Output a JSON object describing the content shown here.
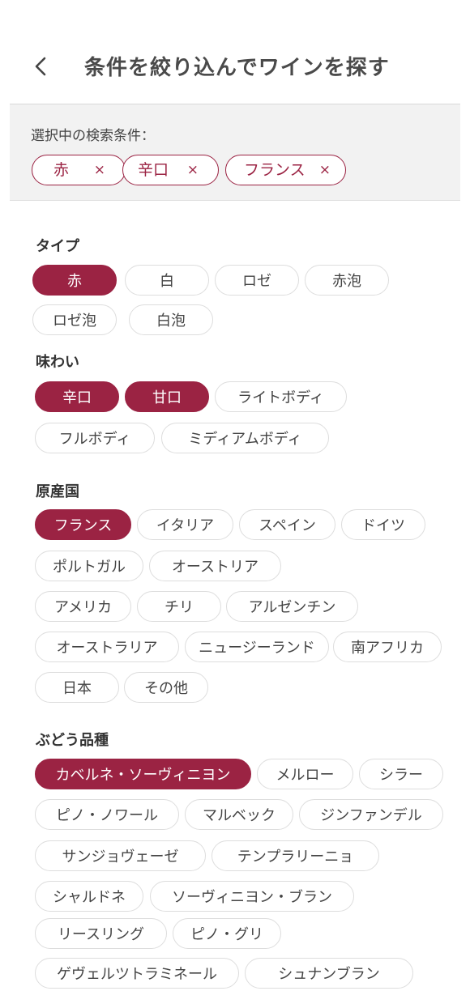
{
  "header": {
    "title": "条件を絞り込んでワインを探す"
  },
  "selected": {
    "label": "選択中の検索条件：",
    "chips": [
      "赤",
      "辛口",
      "フランス"
    ],
    "remove": "×"
  },
  "sections": {
    "type": {
      "title": "タイプ",
      "options": [
        "赤",
        "白",
        "ロゼ",
        "赤泡",
        "ロゼ泡",
        "白泡"
      ]
    },
    "taste": {
      "title": "味わい",
      "options": [
        "辛口",
        "甘口",
        "ライトボディ",
        "フルボディ",
        "ミディアムボディ"
      ]
    },
    "country": {
      "title": "原産国",
      "options": [
        "フランス",
        "イタリア",
        "スペイン",
        "ドイツ",
        "ポルトガル",
        "オーストリア",
        "アメリカ",
        "チリ",
        "アルゼンチン",
        "オーストラリア",
        "ニュージーランド",
        "南アフリカ",
        "日本",
        "その他"
      ]
    },
    "grape": {
      "title": "ぶどう品種",
      "options": [
        "カベルネ・ソーヴィニヨン",
        "メルロー",
        "シラー",
        "ピノ・ノワール",
        "マルベック",
        "ジンファンデル",
        "サンジョヴェーゼ",
        "テンプラリーニョ",
        "シャルドネ",
        "ソーヴィニヨン・ブラン",
        "リースリング",
        "ピノ・グリ",
        "ゲヴェルツトラミネール",
        "シュナンブラン"
      ]
    }
  },
  "colors": {
    "accent": "#9b2343",
    "chip_border": "#dddddd",
    "panel_bg": "#f2f2f2"
  }
}
